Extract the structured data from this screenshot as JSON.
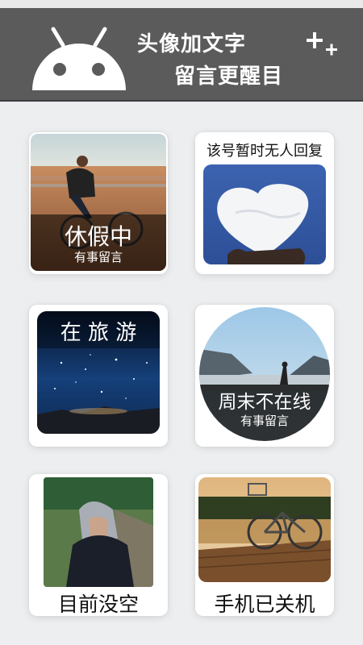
{
  "header": {
    "title_line1": "头像加文字",
    "title_line2": "留言更醒目"
  },
  "cards": [
    {
      "big": "休假中",
      "small": "有事留言"
    },
    {
      "top": "该号暂时无人回复"
    },
    {
      "top": "在 旅 游"
    },
    {
      "big": "周末不在线",
      "small": "有事留言"
    },
    {
      "bottom": "目前没空"
    },
    {
      "bottom": "手机已关机"
    }
  ],
  "icons": [
    "android-icon",
    "add-icon"
  ],
  "colors": {
    "header": "#5b5b5b",
    "background": "#eceef0",
    "card": "#ffffff"
  }
}
